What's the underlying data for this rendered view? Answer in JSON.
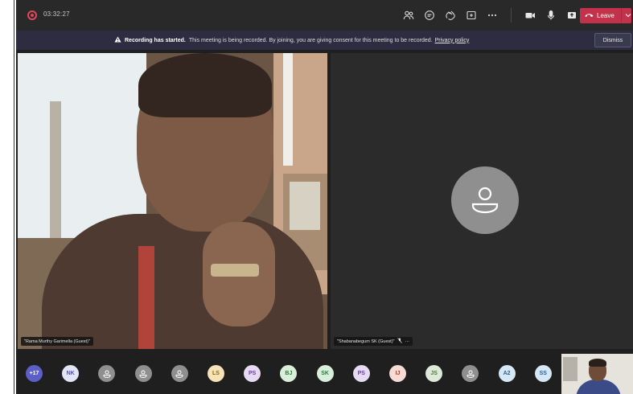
{
  "topbar": {
    "timer": "03:32:27",
    "icons": [
      "participants-icon",
      "chat-icon",
      "reactions-icon",
      "share-tray-icon",
      "more-icon"
    ],
    "controls": [
      "camera-icon",
      "mic-icon",
      "share-icon"
    ],
    "leave_label": "Leave"
  },
  "banner": {
    "title": "Recording has started.",
    "message": "This meeting is being recorded. By joining, you are giving consent for this meeting to be recorded.",
    "link": "Privacy policy",
    "dismiss_label": "Dismiss"
  },
  "tiles": [
    {
      "name": "\"Rama Murthy Garimella (Guest)\""
    },
    {
      "name": "\"Shabanabegum SK (Guest)\"",
      "more": "···"
    }
  ],
  "participants": [
    {
      "label": "+17",
      "bg": "#5b5fc7",
      "fg": "#ffffff"
    },
    {
      "label": "NK",
      "bg": "#e4e4f7",
      "fg": "#4f52b2"
    },
    {
      "label": "",
      "bg": "#8f8f8f",
      "fg": "#ffffff",
      "icon": "person-icon"
    },
    {
      "label": "",
      "bg": "#8f8f8f",
      "fg": "#ffffff",
      "icon": "person-icon"
    },
    {
      "label": "",
      "bg": "#8f8f8f",
      "fg": "#ffffff",
      "icon": "person-icon"
    },
    {
      "label": "LS",
      "bg": "#f6e4b8",
      "fg": "#8a6a10"
    },
    {
      "label": "PS",
      "bg": "#e6dbf3",
      "fg": "#6b3fa0"
    },
    {
      "label": "BJ",
      "bg": "#d9efdb",
      "fg": "#2f7a3a"
    },
    {
      "label": "SK",
      "bg": "#d9efdb",
      "fg": "#2f7a3a"
    },
    {
      "label": "PS",
      "bg": "#e6dbf3",
      "fg": "#6b3fa0"
    },
    {
      "label": "IJ",
      "bg": "#f7dcd6",
      "fg": "#b23a2a"
    },
    {
      "label": "JS",
      "bg": "#dfe9d9",
      "fg": "#4f7a3a"
    },
    {
      "label": "",
      "bg": "#8f8f8f",
      "fg": "#ffffff",
      "icon": "person-icon"
    },
    {
      "label": "A2",
      "bg": "#d6e7f5",
      "fg": "#2b5f94"
    },
    {
      "label": "SS",
      "bg": "#d6e7f5",
      "fg": "#2b5f94"
    }
  ],
  "colors": {
    "leave": "#c4314b",
    "topbar": "#292929",
    "banner": "#2d2c40",
    "stage": "#1f1f1f"
  }
}
